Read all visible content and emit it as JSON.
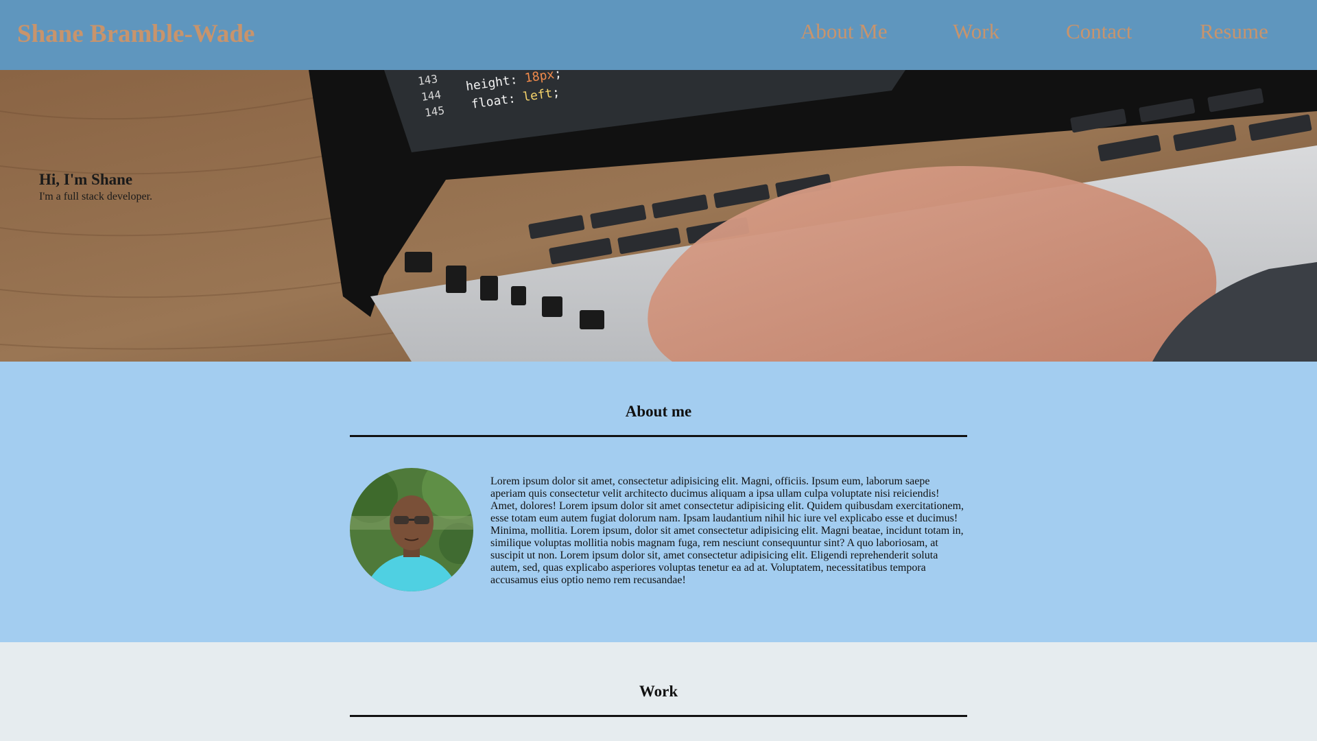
{
  "header": {
    "brand": "Shane Bramble-Wade",
    "nav": [
      {
        "label": "About Me"
      },
      {
        "label": "Work"
      },
      {
        "label": "Contact"
      },
      {
        "label": "Resume"
      }
    ]
  },
  "hero": {
    "title": "Hi, I'm Shane",
    "subtitle": "I'm a full stack developer.",
    "image": "laptop-coding-photo"
  },
  "about": {
    "heading": "About me",
    "avatar": "profile-photo",
    "body": "Lorem ipsum dolor sit amet, consectetur adipisicing elit. Magni, officiis. Ipsum eum, laborum saepe aperiam quis consectetur velit architecto ducimus aliquam a ipsa ullam culpa voluptate nisi reiciendis! Amet, dolores! Lorem ipsum dolor sit amet consectetur adipisicing elit. Quidem quibusdam exercitationem, esse totam eum autem fugiat dolorum nam. Ipsam laudantium nihil hic iure vel explicabo esse et ducimus! Minima, mollitia. Lorem ipsum, dolor sit amet consectetur adipisicing elit. Magni beatae, incidunt totam in, similique voluptas mollitia nobis magnam fuga, rem nesciunt consequuntur sint? A quo laboriosam, at suscipit ut non. Lorem ipsum dolor sit, amet consectetur adipisicing elit. Eligendi reprehenderit soluta autem, sed, quas explicabo asperiores voluptas tenetur ea ad at. Voluptatem, necessitatibus tempora accusamus eius optio nemo rem recusandae!"
  },
  "work": {
    "heading": "Work"
  },
  "colors": {
    "header_bg": "#5f96be",
    "brand_nav_text": "#c8946c",
    "about_bg": "#a3cdf0",
    "work_bg": "#e6ecef"
  }
}
